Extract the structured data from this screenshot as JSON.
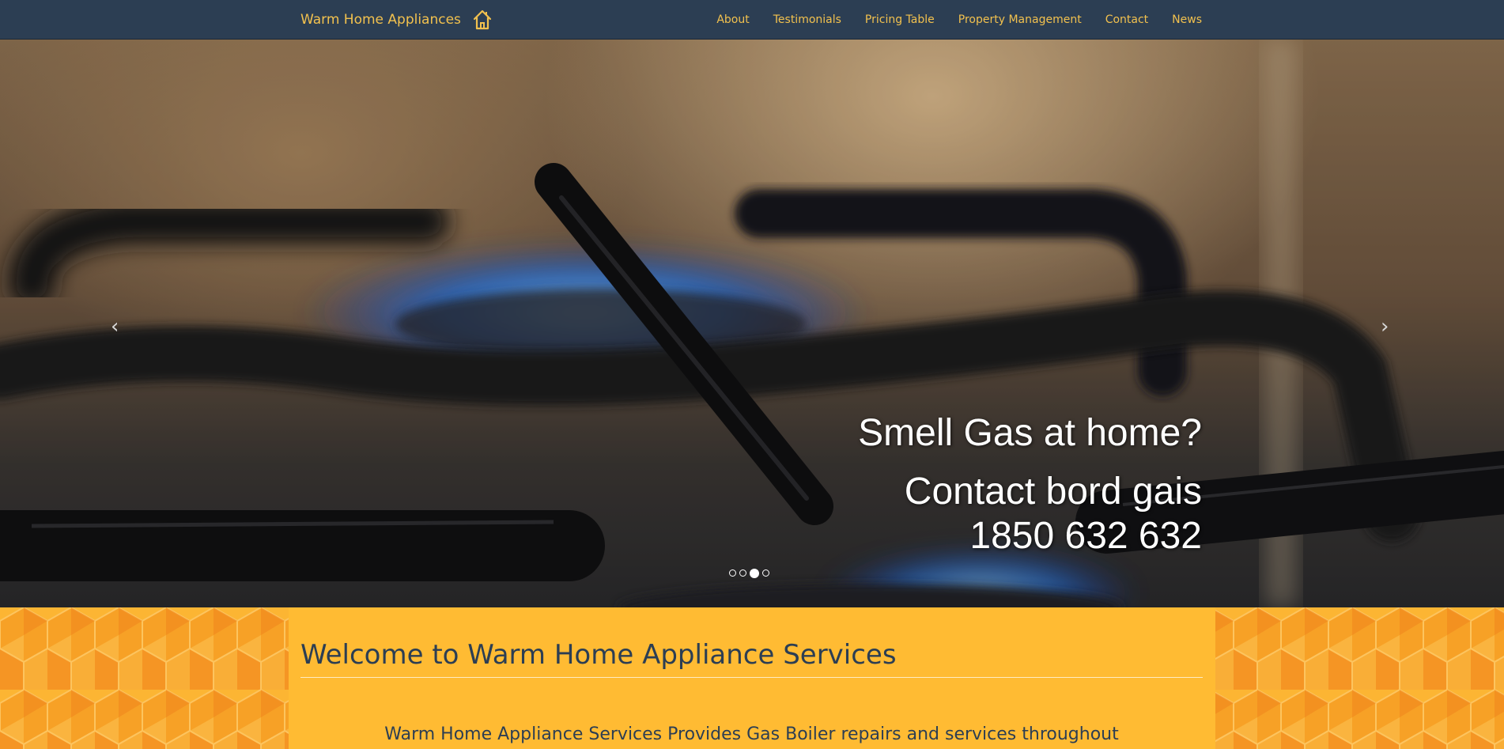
{
  "navbar": {
    "brand": "Warm Home Appliances",
    "links": [
      "About",
      "Testimonials",
      "Pricing Table",
      "Property Management",
      "Contact",
      "News"
    ]
  },
  "hero": {
    "caption_line1": "Smell Gas at home?",
    "caption_line2": "Contact bord gais",
    "caption_line3": "1850 632 632",
    "prev_arrow": "‹",
    "next_arrow": "›",
    "slides_total": 4,
    "active_slide": 3
  },
  "welcome": {
    "title": "Welcome to Warm Home Appliance Services",
    "text": "Warm Home Appliance Services Provides Gas Boiler repairs and services throughout"
  },
  "colors": {
    "navbar_bg": "#2c3e53",
    "accent": "#f2c14e",
    "welcome_bg": "#ffbb33",
    "welcome_text": "#2c3e53"
  }
}
